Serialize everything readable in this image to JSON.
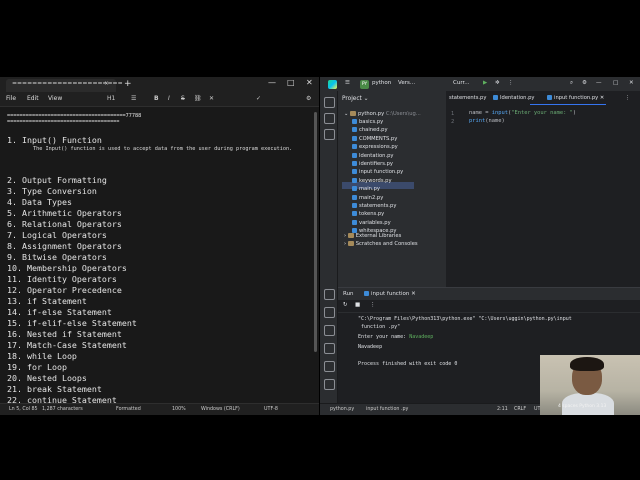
{
  "notepad": {
    "tab_title": "======================",
    "tab_close": "×",
    "new_tab": "+",
    "window_controls": [
      "—",
      "□",
      "✕"
    ],
    "menu": [
      "File",
      "Edit",
      "View"
    ],
    "toolbar": {
      "heading": "H1",
      "list": "☰",
      "bold": "B",
      "italic": "I",
      "strike": "S",
      "link": "⛓",
      "clear": "✕",
      "spell": "✓",
      "gear": "⚙"
    },
    "lines": {
      "sep1": "======================================77788",
      "sep2": "====================================",
      "item1": "1. Input() Function",
      "desc1": "The Input() function is used to accept data from the user during program execution.",
      "items": [
        "2. Output Formatting",
        "3. Type Conversion",
        "4. Data Types",
        "5. Arithmetic Operators",
        "6. Relational Operators",
        "7. Logical Operators",
        "8. Assignment Operators",
        "9. Bitwise Operators",
        "10. Membership Operators",
        "11. Identity Operators",
        "12. Operator Precedence",
        "13. if Statement",
        "14. if-else Statement",
        "15. if-elif-else Statement",
        "16. Nested if Statement",
        "17. Match-Case Statement",
        "18. while Loop",
        "19. for Loop",
        "20. Nested Loops",
        "21. break Statement",
        "22. continue Statement"
      ]
    },
    "status": {
      "position": "Ln 5, Col 85",
      "chars": "1,287 characters",
      "format": "Formatted",
      "zoom": "100%",
      "eol": "Windows (CRLF)",
      "encoding": "UTF-8"
    }
  },
  "ide": {
    "title_project": "python",
    "title_vcs": "Vers...",
    "title_config": "Curr...",
    "proj_badge": "PY",
    "project_header": "Project",
    "tree_root": "python.py",
    "tree_root_path": "C:\\Users\\ug...",
    "files": [
      "basics.py",
      "chained.py",
      "COMMENTS.py",
      "expressions.py",
      "Identation.py",
      "identifiers.py",
      "input function.py",
      "keywords.py",
      "main.py",
      "main2.py",
      "statements.py",
      "tokens.py",
      "variables.py",
      "whitespace.py"
    ],
    "external": "External Libraries",
    "scratches": "Scratches and Consoles",
    "tabs": [
      "statements.py",
      "Identation.py",
      "input function.py"
    ],
    "line_numbers": [
      "1",
      "2"
    ],
    "code": {
      "l1_a": "name",
      "l1_b": " = ",
      "l1_c": "input",
      "l1_d": "(",
      "l1_e": "\"Enter your name: \"",
      "l1_f": ")",
      "l2_a": "print",
      "l2_b": "(name)"
    },
    "run": {
      "tab_label": "Run",
      "config_label": "input function",
      "cmd": "\"C:\\Program Files\\Python313\\python.exe\" \"C:\\Users\\uggin\\python.py\\input",
      "cmd2": " function .py\"",
      "prompt": "Enter your name: ",
      "input": "Navadeep",
      "output": "Navadeep",
      "exit": "Process finished with exit code 0"
    },
    "status": {
      "breadcrumb_1": "python.py",
      "breadcrumb_2": "input function .py",
      "pos": "2:11",
      "eol": "CRLF",
      "enc": "UTF-8"
    }
  },
  "webcam": {
    "caption": "4 spaces  Python 3.13"
  }
}
